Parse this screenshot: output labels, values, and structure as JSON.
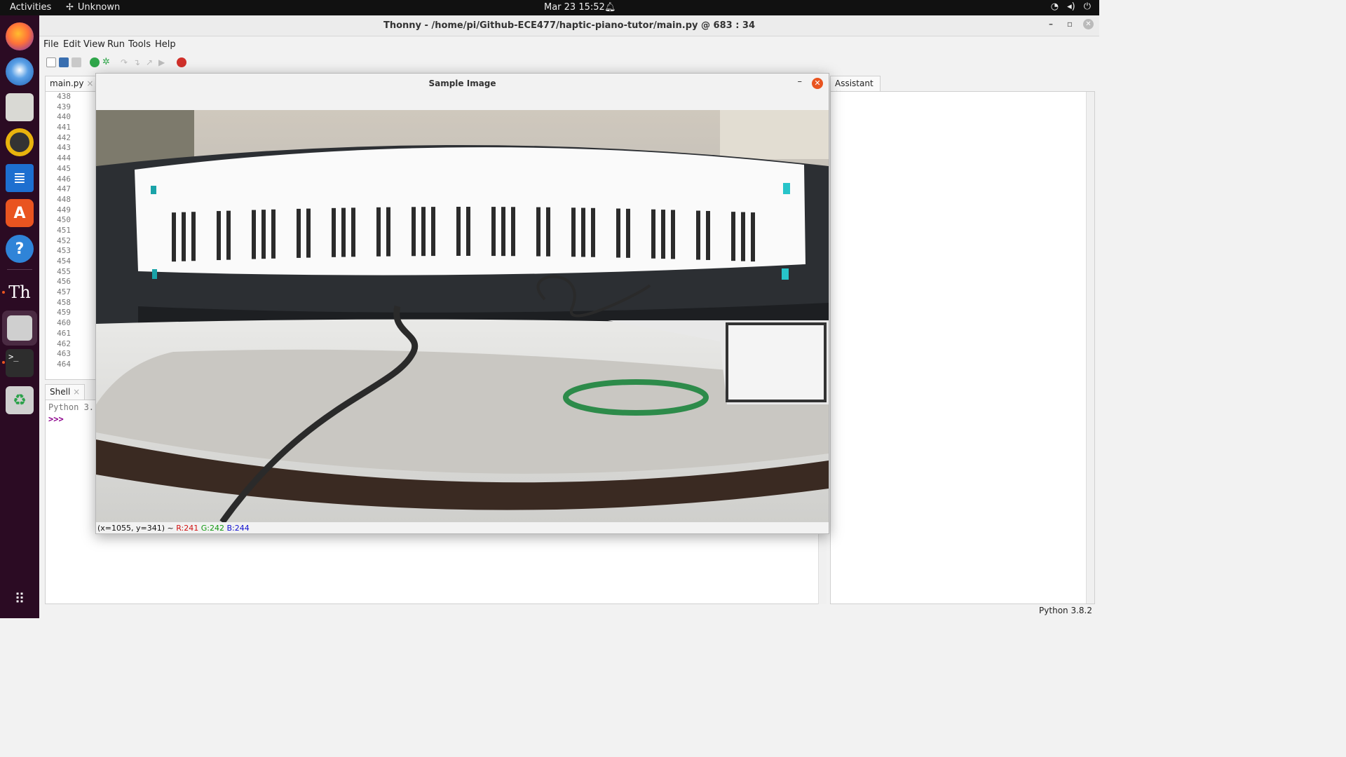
{
  "topbar": {
    "activities": "Activities",
    "network": "Unknown",
    "clock": "Mar 23  15:52"
  },
  "window": {
    "title": "Thonny  -  /home/pi/Github-ECE477/haptic-piano-tutor/main.py  @  683 : 34"
  },
  "menu": [
    "File",
    "Edit",
    "View",
    "Run",
    "Tools",
    "Help"
  ],
  "editor": {
    "tab": "main.py",
    "line_numbers": [
      "438",
      "439",
      "440",
      "441",
      "442",
      "443",
      "444",
      "445",
      "446",
      "447",
      "448",
      "449",
      "450",
      "451",
      "452",
      "453",
      "454",
      "455",
      "456",
      "457",
      "458",
      "459",
      "460",
      "461",
      "462",
      "463",
      "464"
    ]
  },
  "shell": {
    "tab": "Shell",
    "info": "Python 3.",
    "prompt": ">>>"
  },
  "assistant": {
    "tab": "Assistant"
  },
  "status": "Python 3.8.2",
  "image_window": {
    "title": "Sample Image",
    "coords": "(x=1055, y=341) ~",
    "r": "R:241",
    "g": "G:242",
    "b": "B:244"
  },
  "colors": {
    "accent": "#e95420",
    "dock": "#2b0b23"
  }
}
